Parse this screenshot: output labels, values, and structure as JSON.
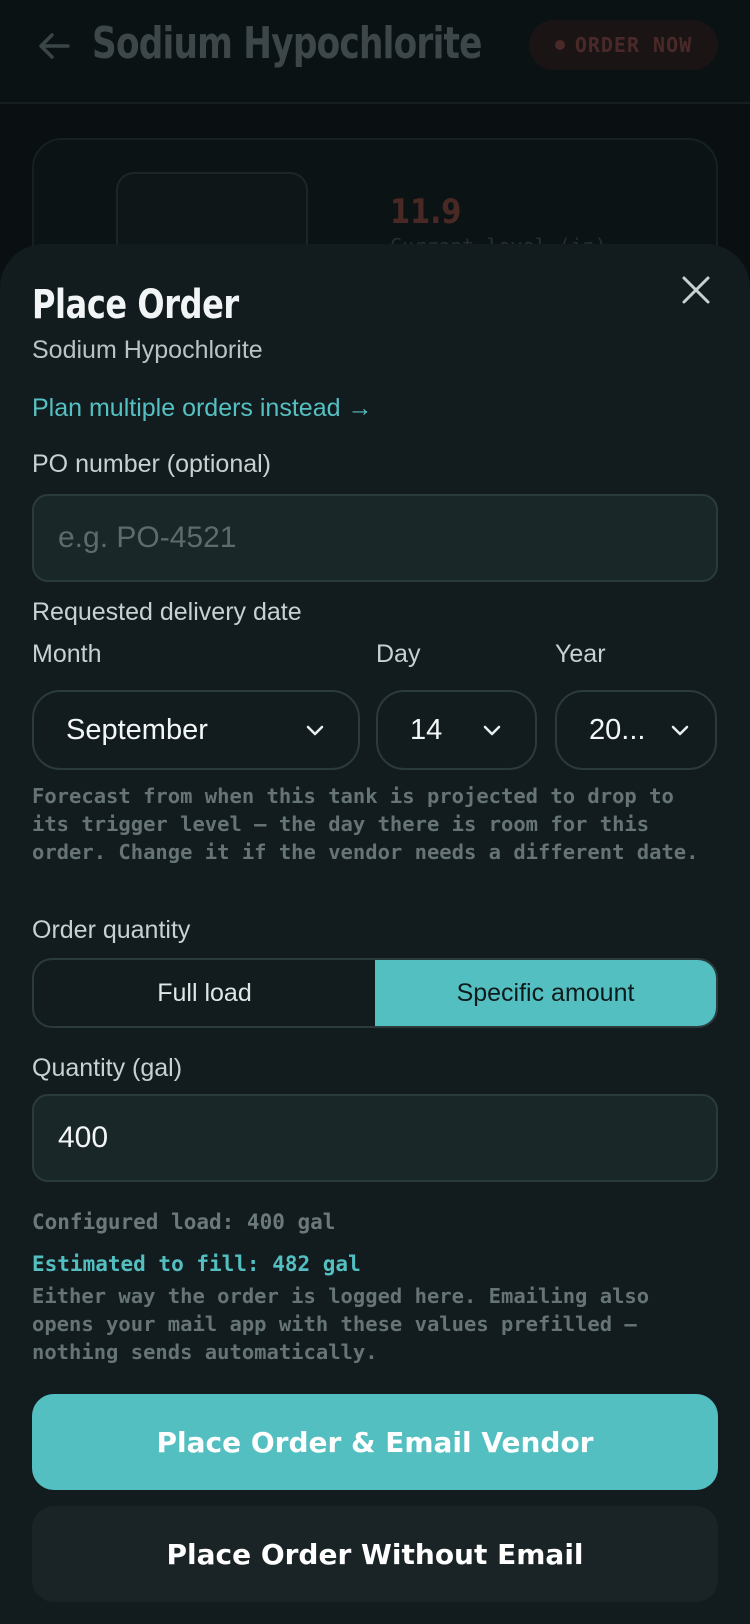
{
  "background": {
    "title": "Sodium Hypochlorite",
    "badge_label": "ORDER NOW",
    "level_value": "11.9",
    "level_label": "Current level (in)"
  },
  "sheet": {
    "title": "Place Order",
    "subtitle": "Sodium Hypochlorite",
    "plan_link": "Plan multiple orders instead →",
    "po_label": "PO number (optional)",
    "po_placeholder": "e.g. PO-4521",
    "po_value": "",
    "date_label": "Requested delivery date",
    "month_label": "Month",
    "day_label": "Day",
    "year_label": "Year",
    "month_value": "September",
    "day_value": "14",
    "year_value": "20...",
    "date_hint": "Forecast from when this tank is projected to drop to its trigger level — the day there is room for this order. Change it if the vendor needs a different date.",
    "quantity_label": "Order quantity",
    "quantity_options": [
      "Full load",
      "Specific amount"
    ],
    "quantity_selected": "Specific amount",
    "amount_label": "Quantity (gal)",
    "amount_value": "400",
    "configured_load": "Configured load: 400 gal",
    "estimated_fill": "Estimated to fill: 482 gal",
    "email_note": "Either way the order is logged here. Emailing also opens your mail app with these values prefilled — nothing sends automatically.",
    "primary_button": "Place Order & Email Vendor",
    "secondary_button": "Place Order Without Email"
  },
  "colors": {
    "accent": "#54bfc1",
    "sheet_bg": "#121c1e",
    "page_bg": "#0a1012",
    "alert": "#4a2a28"
  },
  "icons": {
    "back": "arrow-left-icon",
    "close": "close-icon",
    "dropdown": "chevron-down-icon"
  }
}
